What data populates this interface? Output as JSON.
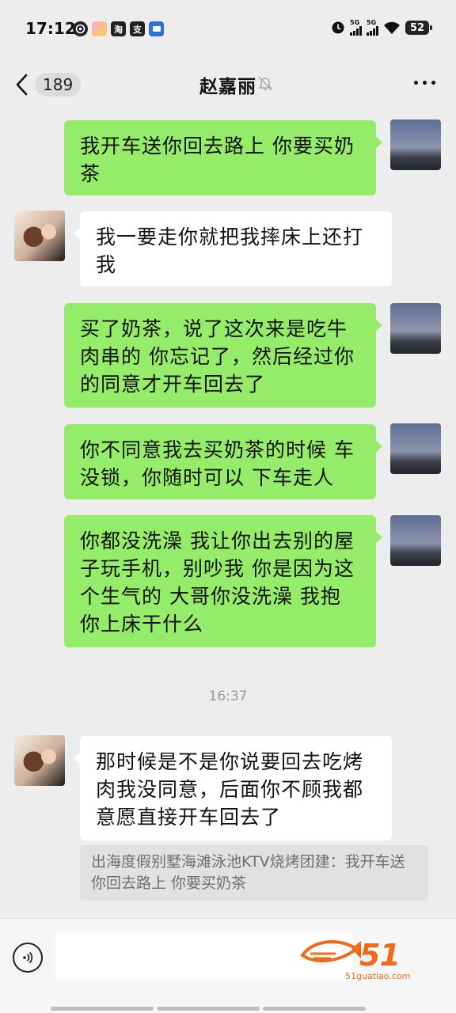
{
  "status_bar": {
    "time": "17:12",
    "app_icons": [
      "wechat-moment-icon",
      "app-icon",
      "taobao-icon",
      "alipay-icon",
      "message-icon"
    ],
    "taobao_glyph": "淘",
    "alipay_glyph": "支",
    "network_1": "5G",
    "network_2": "5G",
    "battery": "52"
  },
  "nav": {
    "unread_count": "189",
    "title": "赵嘉丽"
  },
  "messages": [
    {
      "sender": "me",
      "text": "我开车送你回去路上 你要买奶茶"
    },
    {
      "sender": "other",
      "text": "我一要走你就把我摔床上还打我"
    },
    {
      "sender": "me",
      "text": "买了奶茶，说了这次来是吃牛肉串的  你忘记了，然后经过你的同意才开车回去了"
    },
    {
      "sender": "me",
      "text": "你不同意我去买奶茶的时候 车没锁，你随时可以 下车走人"
    },
    {
      "sender": "me",
      "text": "你都没洗澡  我让你出去别的屋子玩手机，别吵我  你是因为这个生气的  大哥你没洗澡 我抱你上床干什么"
    },
    {
      "sender": "other",
      "text": "那时候是不是你说要回去吃烤肉我没同意，后面你不顾我都意愿直接开车回去了"
    }
  ],
  "timestamp": "16:37",
  "quote": "出海度假别墅海滩泳池KTV烧烤团建：我开车送你回去路上 你要买奶茶",
  "watermark": {
    "text": "51",
    "url": "51guatiao.com"
  },
  "colors": {
    "sent_bubble": "#95ec69",
    "received_bubble": "#ffffff",
    "background": "#ededed",
    "watermark": "#f06a1a"
  }
}
